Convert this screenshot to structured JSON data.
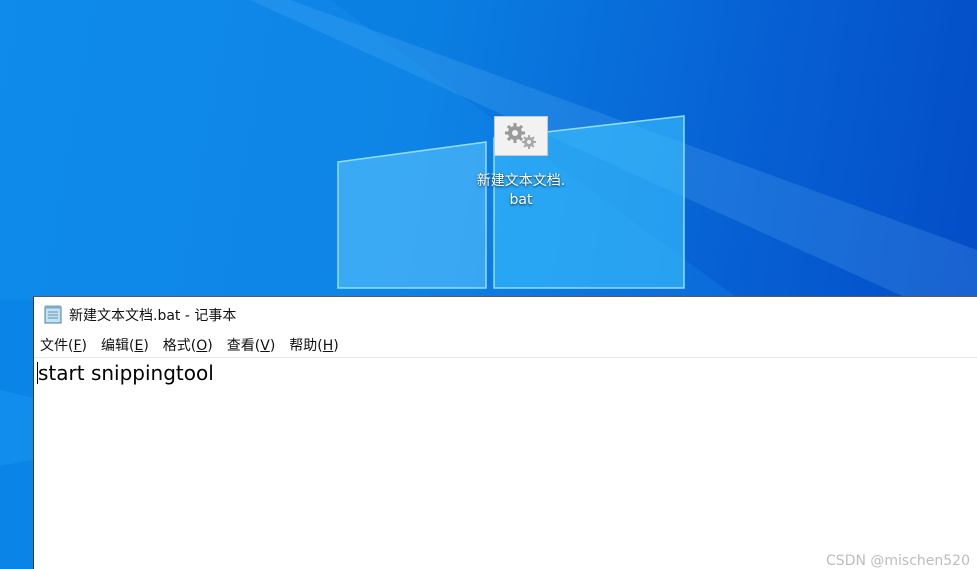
{
  "desktop": {
    "icon": {
      "icon_name": "gears-icon",
      "label": "新建文本文档.bat"
    }
  },
  "notepad": {
    "title": "新建文本文档.bat - 记事本",
    "app_icon": "notepad-icon",
    "menu": [
      {
        "label": "文件",
        "key": "F"
      },
      {
        "label": "编辑",
        "key": "E"
      },
      {
        "label": "格式",
        "key": "O"
      },
      {
        "label": "查看",
        "key": "V"
      },
      {
        "label": "帮助",
        "key": "H"
      }
    ],
    "content": "start snippingtool"
  },
  "watermark": "CSDN @mischen520"
}
